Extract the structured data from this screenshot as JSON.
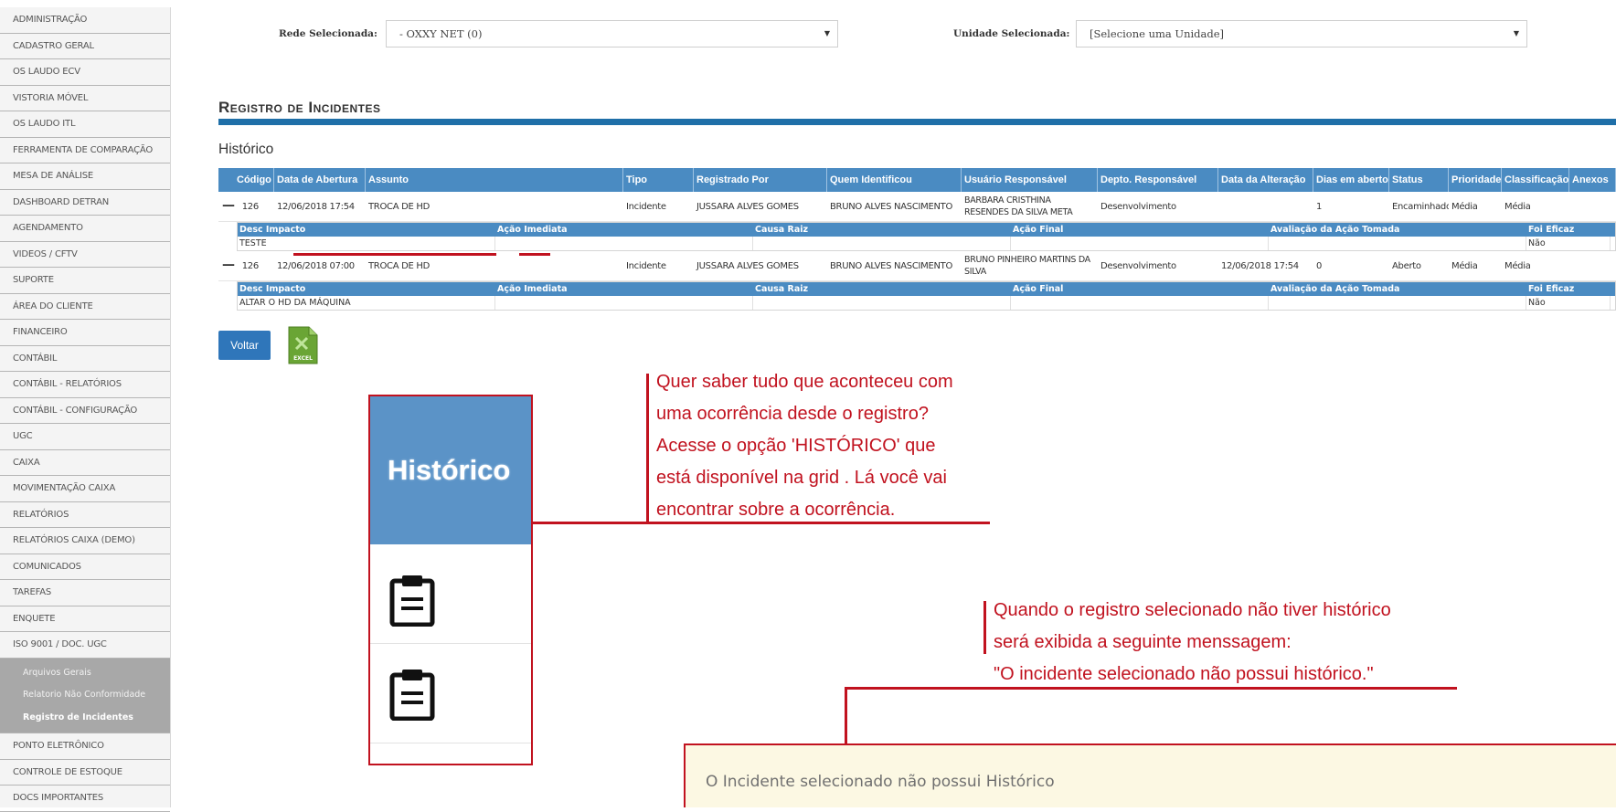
{
  "sidebar": {
    "items": [
      "ADMINISTRAÇÃO",
      "CADASTRO GERAL",
      "OS LAUDO ECV",
      "VISTORIA MÓVEL",
      "OS LAUDO ITL",
      "FERRAMENTA DE COMPARAÇÃO",
      "MESA DE ANÁLISE",
      "DASHBOARD DETRAN",
      "AGENDAMENTO",
      "VIDEOS / CFTV",
      "SUPORTE",
      "ÁREA DO CLIENTE",
      "FINANCEIRO",
      "CONTÁBIL",
      "CONTÁBIL - RELATÓRIOS",
      "CONTÁBIL - CONFIGURAÇÃO",
      "UGC",
      "CAIXA",
      "MOVIMENTAÇÃO CAIXA",
      "RELATÓRIOS",
      "RELATÓRIOS CAIXA (DEMO)",
      "COMUNICADOS",
      "TAREFAS",
      "ENQUETE",
      "ISO 9001 / DOC. UGC"
    ],
    "sub_items": [
      "Arquivos Gerais",
      "Relatorio Não Conformidade",
      "Registro de Incidentes"
    ],
    "items_after": [
      "PONTO ELETRÔNICO",
      "CONTROLE DE ESTOQUE",
      "DOCS IMPORTANTES"
    ]
  },
  "filters": {
    "rede_label": "Rede Selecionada:",
    "rede_value": "- OXXY NET (0)",
    "unidade_label": "Unidade Selecionada:",
    "unidade_value": "[Selecione uma Unidade]"
  },
  "page": {
    "title": "Registro de Incidentes",
    "section": "Histórico"
  },
  "grid": {
    "headers": [
      "Código",
      "Data de Abertura",
      "Assunto",
      "Tipo",
      "Registrado Por",
      "Quem Identificou",
      "Usuário Responsável",
      "Depto. Responsável",
      "Data da Alteração",
      "Dias em aberto",
      "Status",
      "Prioridade",
      "Classificação",
      "Anexos"
    ],
    "sub_headers": [
      "Desc Impacto",
      "Ação Imediata",
      "Causa Raiz",
      "Ação Final",
      "Avaliação da Ação Tomada",
      "Foi Eficaz"
    ],
    "rows": [
      {
        "toggle": "—",
        "codigo": "126",
        "data_abertura": "12/06/2018 17:54",
        "assunto": "TROCA DE HD",
        "tipo": "Incidente",
        "registrado_por": "JUSSARA ALVES GOMES",
        "quem_identificou": "BRUNO ALVES NASCIMENTO",
        "usuario_responsavel": "BARBARA CRISTHINA RESENDES DA SILVA META",
        "depto": "Desenvolvimento",
        "data_alteracao": "",
        "dias": "1",
        "status": "Encaminhado",
        "prioridade": "Média",
        "classificacao": "Média",
        "anexos": "",
        "detail": {
          "desc_impacto": "TESTE",
          "acao_imediata": "",
          "causa_raiz": "",
          "acao_final": "",
          "avaliacao": "",
          "foi_eficaz": "Não"
        }
      },
      {
        "toggle": "—",
        "codigo": "126",
        "data_abertura": "12/06/2018 07:00",
        "assunto": "TROCA DE HD",
        "tipo": "Incidente",
        "registrado_por": "JUSSARA ALVES GOMES",
        "quem_identificou": "BRUNO ALVES NASCIMENTO",
        "usuario_responsavel": "BRUNO PINHEIRO MARTINS DA SILVA",
        "depto": "Desenvolvimento",
        "data_alteracao": "12/06/2018 17:54",
        "dias": "0",
        "status": "Aberto",
        "prioridade": "Média",
        "classificacao": "Média",
        "anexos": "",
        "detail": {
          "desc_impacto": "ALTAR O HD DA MÁQUINA",
          "acao_imediata": "",
          "causa_raiz": "",
          "acao_final": "",
          "avaliacao": "",
          "foi_eficaz": "Não"
        }
      }
    ]
  },
  "actions": {
    "voltar": "Voltar",
    "excel_label": "EXCEL"
  },
  "callout": {
    "zoom_header": "Histórico",
    "text1_lines": [
      "Quer saber  tudo que aconteceu com",
      "uma ocorrência desde o registro?",
      "Acesse o opção 'HISTÓRICO' que",
      "está disponível na grid . Lá você vai",
      "encontrar sobre a ocorrência."
    ],
    "text2_lines": [
      "Quando o registro selecionado não tiver histórico",
      "será exibida a seguinte menssagem:",
      "\"O incidente selecionado não possui histórico.\""
    ],
    "message": "O Incidente selecionado não possui Histórico"
  },
  "colors": {
    "header_blue": "#4a8bc2",
    "title_bar": "#1f6fa8",
    "button_blue": "#2f76ba",
    "annotation_red": "#c1121f",
    "message_bg": "#fcf8e3"
  }
}
